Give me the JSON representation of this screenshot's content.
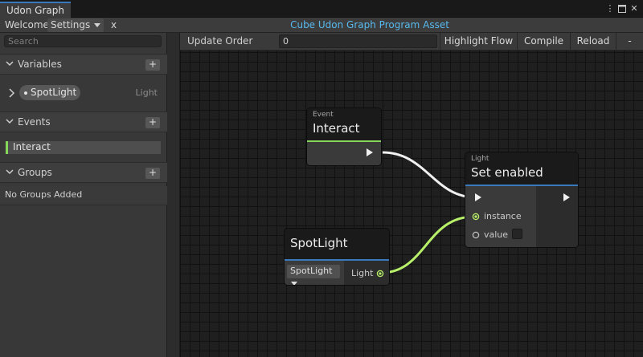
{
  "window": {
    "title": "Udon Graph"
  },
  "toolbar": {
    "welcome": "Welcome",
    "settings": "Settings",
    "close_x": "x",
    "asset_title": "Cube Udon Graph Program Asset"
  },
  "sidebar": {
    "search_placeholder": "Search",
    "variables": {
      "label": "Variables",
      "add": "+",
      "items": [
        {
          "name": "SpotLight",
          "type": "Light"
        }
      ]
    },
    "events": {
      "label": "Events",
      "add": "+",
      "items": [
        {
          "name": "Interact"
        }
      ]
    },
    "groups": {
      "label": "Groups",
      "add": "+",
      "empty_text": "No Groups Added"
    }
  },
  "graph_toolbar": {
    "update_order_label": "Update Order",
    "update_order_value": "0",
    "highlight_flow": "Highlight Flow",
    "compile": "Compile",
    "reload": "Reload",
    "minus": "-"
  },
  "nodes": {
    "interact": {
      "subtitle": "Event",
      "title": "Interact"
    },
    "set_enabled": {
      "subtitle": "Light",
      "title": "Set enabled",
      "inputs": [
        "instance",
        "value"
      ]
    },
    "spotlight": {
      "title": "SpotLight",
      "dropdown": "SpotLight",
      "output": "Light"
    }
  },
  "colors": {
    "accent_blue": "#3a79bb",
    "asset_title_blue": "#58b9ee",
    "event_green": "#86d65c",
    "wire_green": "#b8f06a",
    "wire_white": "#f0f0f0"
  }
}
